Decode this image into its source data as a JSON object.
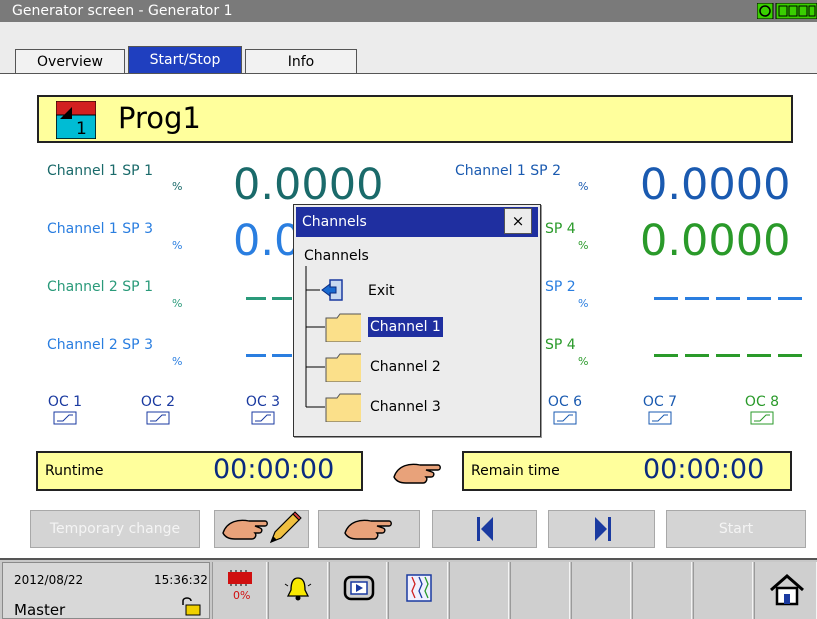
{
  "window": {
    "title": "Generator screen - Generator 1"
  },
  "tabs": [
    {
      "label": "Overview"
    },
    {
      "label": "Start/Stop"
    },
    {
      "label": "Info"
    }
  ],
  "program": {
    "number": "1",
    "name": "Prog1"
  },
  "channels": [
    {
      "label": "Channel 1 SP 1",
      "unit": "%",
      "value": "0.0000",
      "color": "#1a6a6a"
    },
    {
      "label": "Channel 1 SP 2",
      "unit": "%",
      "value": "0.0000",
      "color": "#1a5ab0"
    },
    {
      "label": "Channel 1 SP 3",
      "unit": "%",
      "value": "0.0",
      "color": "#2a7ee0"
    },
    {
      "label": "SP 4",
      "unit": "%",
      "value": "0.0000",
      "color": "#2a9a2a"
    },
    {
      "label": "Channel 2 SP 1",
      "unit": "%",
      "color": "#2a9a7a"
    },
    {
      "label": "SP 2",
      "unit": "%",
      "color": "#2a7ee0"
    },
    {
      "label": "Channel 2 SP 3",
      "unit": "%",
      "color": "#2a7ee0"
    },
    {
      "label": "SP 4",
      "unit": "%",
      "color": "#2a9a2a"
    }
  ],
  "oc": [
    {
      "label": "OC 1"
    },
    {
      "label": "OC 2"
    },
    {
      "label": "OC 3"
    },
    {
      "label": "OC 6"
    },
    {
      "label": "OC 7"
    },
    {
      "label": "OC 8"
    }
  ],
  "runtime": {
    "label": "Runtime",
    "value": "00:00:00"
  },
  "remain": {
    "label": "Remain time",
    "value": "00:00:00"
  },
  "buttons": {
    "temporary_change": "Temporary change",
    "start": "Start"
  },
  "popup": {
    "title": "Channels",
    "close": "×",
    "root": "Channels",
    "items": [
      {
        "label": "Exit"
      },
      {
        "label": "Channel 1"
      },
      {
        "label": "Channel 2"
      },
      {
        "label": "Channel 3"
      }
    ]
  },
  "status": {
    "date": "2012/08/22",
    "time": "15:36:32",
    "user": "Master",
    "storage_percent": "0%"
  },
  "colors": {
    "accent": "#1f2fa0",
    "highlight": "#ffff9c"
  }
}
